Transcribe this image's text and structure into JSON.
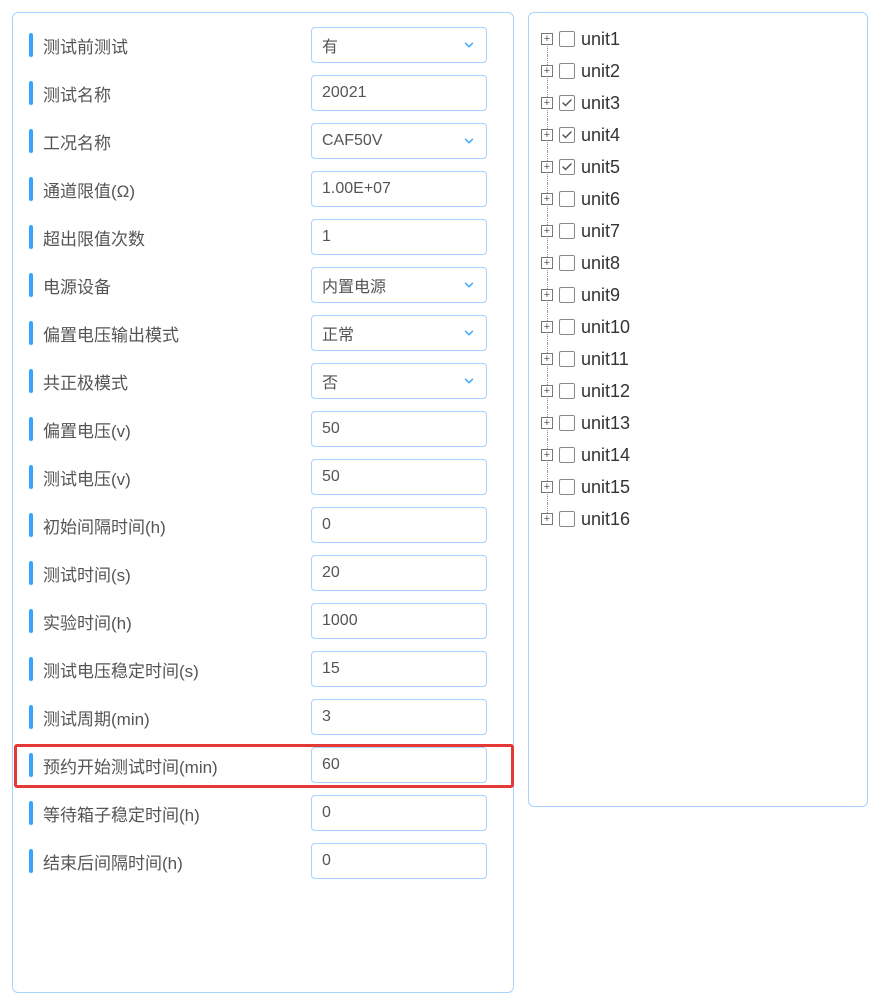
{
  "form": {
    "rows": [
      {
        "label": "测试前测试",
        "value": "有",
        "type": "select"
      },
      {
        "label": "测试名称",
        "value": "20021",
        "type": "text"
      },
      {
        "label": "工况名称",
        "value": "CAF50V",
        "type": "select"
      },
      {
        "label": "通道限值(Ω)",
        "value": "1.00E+07",
        "type": "text"
      },
      {
        "label": "超出限值次数",
        "value": "1",
        "type": "text"
      },
      {
        "label": "电源设备",
        "value": "内置电源",
        "type": "select"
      },
      {
        "label": "偏置电压输出模式",
        "value": "正常",
        "type": "select"
      },
      {
        "label": "共正极模式",
        "value": "否",
        "type": "select"
      },
      {
        "label": "偏置电压(v)",
        "value": "50",
        "type": "text"
      },
      {
        "label": "测试电压(v)",
        "value": "50",
        "type": "text"
      },
      {
        "label": "初始间隔时间(h)",
        "value": "0",
        "type": "text"
      },
      {
        "label": "测试时间(s)",
        "value": "20",
        "type": "text"
      },
      {
        "label": "实验时间(h)",
        "value": "1000",
        "type": "text"
      },
      {
        "label": "测试电压稳定时间(s)",
        "value": "15",
        "type": "text"
      },
      {
        "label": "测试周期(min)",
        "value": "3",
        "type": "text"
      },
      {
        "label": "预约开始测试时间(min)",
        "value": "60",
        "type": "text",
        "highlight": true
      },
      {
        "label": "等待箱子稳定时间(h)",
        "value": "0",
        "type": "text"
      },
      {
        "label": "结束后间隔时间(h)",
        "value": "0",
        "type": "text"
      }
    ]
  },
  "tree": {
    "nodes": [
      {
        "label": "unit1",
        "checked": false
      },
      {
        "label": "unit2",
        "checked": false
      },
      {
        "label": "unit3",
        "checked": true
      },
      {
        "label": "unit4",
        "checked": true
      },
      {
        "label": "unit5",
        "checked": true
      },
      {
        "label": "unit6",
        "checked": false
      },
      {
        "label": "unit7",
        "checked": false
      },
      {
        "label": "unit8",
        "checked": false
      },
      {
        "label": "unit9",
        "checked": false
      },
      {
        "label": "unit10",
        "checked": false
      },
      {
        "label": "unit11",
        "checked": false
      },
      {
        "label": "unit12",
        "checked": false
      },
      {
        "label": "unit13",
        "checked": false
      },
      {
        "label": "unit14",
        "checked": false
      },
      {
        "label": "unit15",
        "checked": false
      },
      {
        "label": "unit16",
        "checked": false
      }
    ]
  }
}
